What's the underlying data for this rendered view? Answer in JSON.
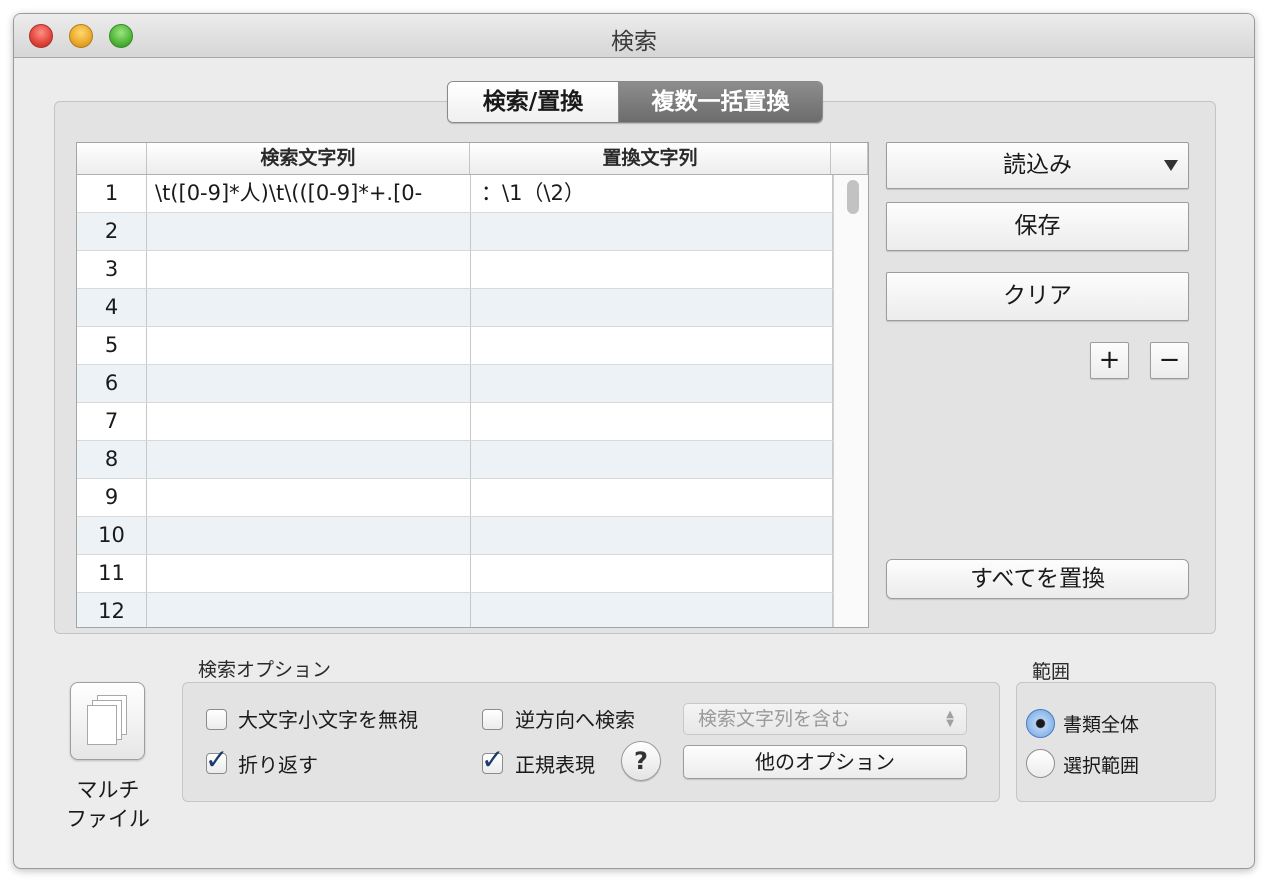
{
  "window": {
    "title": "検索"
  },
  "tabs": [
    {
      "label": "検索/置換",
      "selected": false
    },
    {
      "label": "複数一括置換",
      "selected": true
    }
  ],
  "table": {
    "columns": [
      "",
      "検索文字列",
      "置換文字列"
    ],
    "rows": [
      {
        "num": "1",
        "search": "\\t([0-9]*人)\\t\\(([0-9]*+.[0-",
        "replace": "：\\1（\\2）"
      },
      {
        "num": "2",
        "search": "",
        "replace": ""
      },
      {
        "num": "3",
        "search": "",
        "replace": ""
      },
      {
        "num": "4",
        "search": "",
        "replace": ""
      },
      {
        "num": "5",
        "search": "",
        "replace": ""
      },
      {
        "num": "6",
        "search": "",
        "replace": ""
      },
      {
        "num": "7",
        "search": "",
        "replace": ""
      },
      {
        "num": "8",
        "search": "",
        "replace": ""
      },
      {
        "num": "9",
        "search": "",
        "replace": ""
      },
      {
        "num": "10",
        "search": "",
        "replace": ""
      },
      {
        "num": "11",
        "search": "",
        "replace": ""
      },
      {
        "num": "12",
        "search": "",
        "replace": ""
      }
    ]
  },
  "side_buttons": {
    "load": "読込み",
    "save": "保存",
    "clear": "クリア",
    "add": "+",
    "remove": "−",
    "replace_all": "すべてを置換"
  },
  "options": {
    "group_label": "検索オプション",
    "ignore_case": {
      "label": "大文字小文字を無視",
      "checked": false
    },
    "wrap": {
      "label": "折り返す",
      "checked": true
    },
    "reverse": {
      "label": "逆方向へ検索",
      "checked": false
    },
    "regex": {
      "label": "正規表現",
      "checked": true
    },
    "help": "?",
    "match_popup": "検索文字列を含む",
    "other_options": "他のオプション"
  },
  "scope": {
    "group_label": "範囲",
    "items": [
      {
        "label": "書類全体",
        "selected": true
      },
      {
        "label": "選択範囲",
        "selected": false
      }
    ]
  },
  "multi_file": {
    "label_line1": "マルチ",
    "label_line2": "ファイル"
  },
  "colors": {
    "window_bg": "#ececec",
    "selected_tab": "#7a7a7a",
    "row_alt": "#edf2f7",
    "radio_selected": "#6aa3e6"
  }
}
